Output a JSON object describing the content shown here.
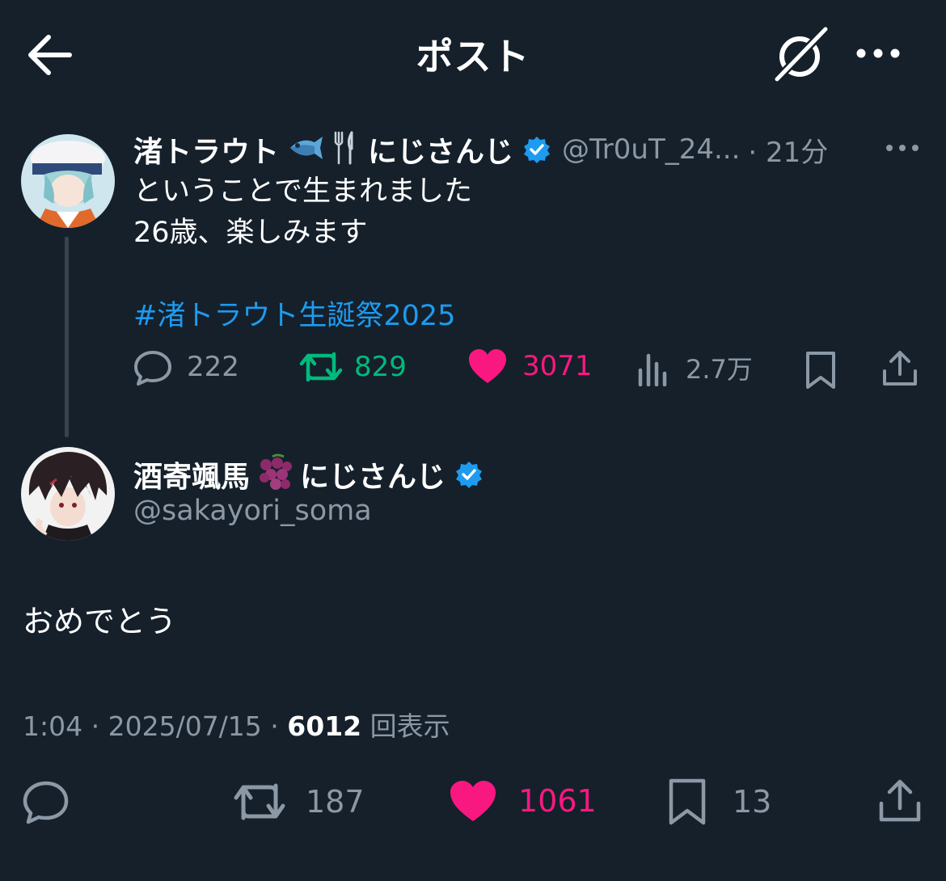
{
  "header": {
    "title": "ポスト",
    "back_icon": "arrow-left-icon",
    "grok_icon": "grok-icon",
    "more_icon": "more-horizontal-icon"
  },
  "colors": {
    "background": "#15202b",
    "accent": "#1d9bf0",
    "retweet": "#00ba7c",
    "like": "#f91880",
    "muted": "#8b98a5"
  },
  "post1": {
    "display_name": "渚トラウト",
    "name_emoji": "🐟🍴",
    "affiliation": "にじさんじ",
    "handle": "@Tr0uT_24...",
    "time": "· 21分",
    "text": "ということで生まれました\n26歳、楽しみます",
    "hashtag": "#渚トラウト生誕祭2025",
    "replies": "222",
    "retweets": "829",
    "likes": "3071",
    "views": "2.7万"
  },
  "post2": {
    "display_name": "酒寄颯馬",
    "name_emoji": "🍇",
    "affiliation": "にじさんじ",
    "handle": "@sakayori_soma",
    "text": "おめでとう",
    "time": "1:04",
    "date": "2025/07/15",
    "views_count": "6012",
    "views_label": "回表示",
    "retweets": "187",
    "likes": "1061",
    "bookmarks": "13"
  }
}
